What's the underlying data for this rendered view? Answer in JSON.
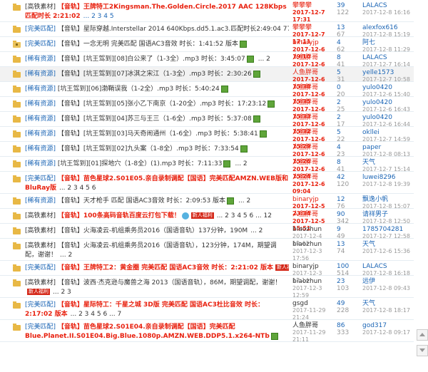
{
  "rows": [
    {
      "h": 30,
      "shade": false,
      "icon": "folder",
      "tag": "[高铁素材]",
      "tag_blue": false,
      "title": "【音轨】王牌特工2Kingsman.The.Golden.Circle.2017 AAC 128Kbps 匹配时长 2:21:02",
      "red": true,
      "extra": "",
      "pages": "... 2 3 4 5",
      "pages_blue": true,
      "author": "攀攀攀",
      "date": "2017-12-7 17:31",
      "date_red": true,
      "replies": "39",
      "views": "122",
      "last": "LALACS",
      "last_date": "2017-12-8 16:16"
    },
    {
      "h": 20,
      "shade": false,
      "icon": "folder",
      "tag": "[完美匹配]",
      "tag_blue": true,
      "title": "【音轨】星际穿越.Interstellar 2014 640Kbps.dd5.1.ac3.匹配时长2:49:04 774MB",
      "red": false,
      "extra": "ico",
      "pages": "... 2",
      "pages_blue": false,
      "author": "攀攀攀",
      "date": "2017-12-7 17:11",
      "date_red": true,
      "replies": "13",
      "views": "67",
      "last": "alexfox616",
      "last_date": "2017-12-8 15:19"
    },
    {
      "h": 20,
      "shade": false,
      "icon": "lock",
      "tag": "[完美匹配]",
      "tag_blue": true,
      "title": "【音轨】一念无明 完美匹配 国语AC3音效 时长：1:41:52 版本",
      "red": false,
      "extra": "ico",
      "pages": "",
      "pages_blue": false,
      "author": "binaryjp",
      "date": "2017-12-6 19:10",
      "date_red": true,
      "replies": "4",
      "views": "62",
      "last": "阿七",
      "last_date": "2017-12-8 11:29"
    },
    {
      "h": 20,
      "shade": false,
      "icon": "folder",
      "tag": "[稀有资源]",
      "tag_blue": true,
      "title": "【音轨】[坑王驾到][08]白公来了（1-3全）.mp3 时长：3:45:07",
      "red": false,
      "extra": "ico",
      "pages": "... 2",
      "pages_blue": false,
      "author": "人鱼胖哥",
      "date": "2017-12-6 15:39",
      "date_red": true,
      "replies": "8",
      "views": "41",
      "last": "LALACS",
      "last_date": "2017-12-7 16:14"
    },
    {
      "h": 20,
      "shade": true,
      "icon": "folder",
      "tag": "[稀有资源]",
      "tag_blue": true,
      "title": "【音轨】[坑王驾到][07]冰淇之宋江（1-3全）.mp3 时长：2:30:26",
      "red": false,
      "extra": "ico",
      "pages": "",
      "pages_blue": false,
      "author": "人鱼胖哥",
      "date": "2017-12-6 15:38",
      "date_red": true,
      "replies": "5",
      "views": "31",
      "last": "yelle1573",
      "last_date": "2017-12-7 10:58"
    },
    {
      "h": 20,
      "shade": false,
      "icon": "folder",
      "tag": "[稀有资源]",
      "tag_blue": true,
      "title": "[坑王驾到][06]渤鞘误我（1-2全）.mp3 时长：5:40:24",
      "red": false,
      "extra": "ico",
      "pages": "",
      "pages_blue": false,
      "author": "人鱼胖哥",
      "date": "2017-12-6 15:35",
      "date_red": true,
      "replies": "0",
      "views": "20",
      "last": "yulo0420",
      "last_date": "2017-12-6 15:40"
    },
    {
      "h": 20,
      "shade": false,
      "icon": "folder",
      "tag": "[稀有资源]",
      "tag_blue": true,
      "title": "【音轨】[坑王驾到][05]张小乙下南京（1-20全）.mp3 时长：17:23:12",
      "red": false,
      "extra": "ico",
      "pages": "",
      "pages_blue": false,
      "author": "人鱼胖哥",
      "date": "2017-12-6 15:33",
      "date_red": true,
      "replies": "2",
      "views": "25",
      "last": "yulo0420",
      "last_date": "2017-12-6 16:43"
    },
    {
      "h": 20,
      "shade": false,
      "icon": "folder",
      "tag": "[稀有资源]",
      "tag_blue": true,
      "title": "【音轨】[坑王驾到][04]苏三与王三（1-6全）.mp3 时长：5:37:08",
      "red": false,
      "extra": "ico",
      "pages": "",
      "pages_blue": false,
      "author": "人鱼胖哥",
      "date": "2017-12-6 15:32",
      "date_red": true,
      "replies": "2",
      "views": "17",
      "last": "yulo0420",
      "last_date": "2017-12-6 16:44"
    },
    {
      "h": 20,
      "shade": false,
      "icon": "folder",
      "tag": "[稀有资源]",
      "tag_blue": true,
      "title": "【音轨】[坑王驾到][03]马天奇闹通州（1-6全）.mp3 时长：5:38:41",
      "red": false,
      "extra": "ico",
      "pages": "",
      "pages_blue": false,
      "author": "人鱼胖哥",
      "date": "2017-12-6 15:29",
      "date_red": true,
      "replies": "5",
      "views": "22",
      "last": "okllei",
      "last_date": "2017-12-7 14:59"
    },
    {
      "h": 20,
      "shade": false,
      "icon": "folder",
      "tag": "[稀有资源]",
      "tag_blue": true,
      "title": "【音轨】[坑王驾到][02]九头案（1-8全）.mp3 时长：7:33:54",
      "red": false,
      "extra": "ico",
      "pages": "",
      "pages_blue": false,
      "author": "人鱼胖哥",
      "date": "2017-12-6 15:26",
      "date_red": true,
      "replies": "4",
      "views": "23",
      "last": "paper",
      "last_date": "2017-12-8 08:13"
    },
    {
      "h": 20,
      "shade": false,
      "icon": "folder",
      "tag": "[稀有资源]",
      "tag_blue": true,
      "title": "[坑王驾到][01]探地穴（1-8全）(1).mp3 时长：7:11:33",
      "red": false,
      "extra": "ico",
      "pages": "... 2",
      "pages_blue": false,
      "author": "人鱼胖哥",
      "date": "2017-12-6 15:24",
      "date_red": true,
      "replies": "8",
      "views": "41",
      "last": "天气",
      "last_date": "2017-12-7 15:14"
    },
    {
      "h": 30,
      "shade": false,
      "icon": "folder",
      "tag": "[完美匹配]",
      "tag_blue": true,
      "title": "【音轨】苗色星球2.S01E05.亲自录制调配【国语】完美匹配AMZN.WEB版和BluRay版",
      "red": true,
      "extra": "",
      "pages": "... 2 3 4 5 6",
      "pages_blue": false,
      "author": "人鱼胖哥",
      "date": "2017-12-6 09:04",
      "date_red": true,
      "replies": "42",
      "views": "120",
      "last": "luwei8296",
      "last_date": "2017-12-8 19:39"
    },
    {
      "h": 20,
      "shade": false,
      "icon": "folder",
      "tag": "[稀有资源]",
      "tag_blue": true,
      "title": "【音轨】天才枪手 匹配 国语AC3音效 时长：2:09:53 版本",
      "red": false,
      "extra": "ico",
      "pages": "... 2",
      "pages_blue": false,
      "author": "binaryjp",
      "date": "2017-12-5 23:34",
      "date_red": true,
      "replies": "12",
      "views": "76",
      "last": "飘逸小帆",
      "last_date": "2017-12-8 15:07"
    },
    {
      "h": 20,
      "shade": false,
      "icon": "folder",
      "tag": "[高铁素材]",
      "tag_blue": false,
      "title": "【音轨】100条高码音轨百度云打包下载！",
      "red": true,
      "extra": "hot",
      "pages": "... 2 3 4 5 6 ... 12",
      "pages_blue": false,
      "author": "人鱼胖哥",
      "date": "2017-12-5 15:51",
      "date_red": true,
      "replies": "90",
      "views": "342",
      "last": "请祥男子",
      "last_date": "2017-12-8 12:50"
    },
    {
      "h": 20,
      "shade": false,
      "icon": "folder",
      "tag": "[高铁素材]",
      "tag_blue": false,
      "title": "【音轨】火海凌云-机组乘务员2016（国语音轨）137分钟，190M",
      "red": false,
      "extra": "",
      "pages": "... 2",
      "pages_blue": false,
      "author": "biaozhun",
      "date": "2017-12-4 19:47",
      "date_red": false,
      "replies": "9",
      "views": "49",
      "last": "1785704281",
      "last_date": "2017-12-7 12:58"
    },
    {
      "h": 30,
      "shade": false,
      "icon": "folder",
      "tag": "[高铁素材]",
      "tag_blue": false,
      "title": "【音轨】火海凌云-机组乘务员2016（国语音轨），123分钟，174M，期望调配，谢谢！",
      "red": false,
      "extra": "",
      "pages": "... 2",
      "pages_blue": false,
      "author": "biaozhun",
      "date": "2017-12-3 17:56",
      "date_red": false,
      "replies": "13",
      "views": "74",
      "last": "天气",
      "last_date": "2017-12-6 15:36"
    },
    {
      "h": 20,
      "shade": false,
      "icon": "folder",
      "tag": "[完美匹配]",
      "tag_blue": true,
      "title": "【音轨】王牌特工2：黄金圈 完美匹配 国语AC3音效 时长：2:21:02 版本",
      "red": true,
      "extra": "hotico",
      "pages": "",
      "pages_blue": false,
      "author": "binaryjp",
      "date": "2017-12-3 17:14",
      "date_red": false,
      "replies": "100",
      "views": "514",
      "last": "LALACS",
      "last_date": "2017-12-8 16:18"
    },
    {
      "h": 30,
      "shade": false,
      "icon": "folder",
      "tag": "[高铁素材]",
      "tag_blue": false,
      "title": "【音轨】波西·杰克逊与魔兽之海 2013（国语音轨），86M，期望调配，谢谢！",
      "red": false,
      "extra": "hot2",
      "pages": "... 2 3",
      "pages_blue": false,
      "author": "biaozhun",
      "date": "2017-12-3 12:59",
      "date_red": false,
      "replies": "23",
      "views": "103",
      "last": "远伊",
      "last_date": "2017-12-8 09:43"
    },
    {
      "h": 30,
      "shade": false,
      "icon": "folder",
      "tag": "[完美匹配]",
      "tag_blue": true,
      "title": "【音轨】星际特工：千星之城 3D版 完美匹配 国语AC3杜比音效 时长：2:17:02 版本",
      "red": true,
      "extra": "",
      "pages": "... 2 3 4 5 6 ... 7",
      "pages_blue": false,
      "author": "gsgd",
      "date": "2017-11-29 21:24",
      "date_red": false,
      "replies": "49",
      "views": "228",
      "last": "天气",
      "last_date": "2017-12-8 18:17"
    },
    {
      "h": 30,
      "shade": false,
      "icon": "folder",
      "tag": "[完美匹配]",
      "tag_blue": true,
      "title": "【音轨】苗色星球2.S01E04.亲自录制调配【国语】完美匹配 Blue.Planet.II.S01E04.Big.Blue.1080p.AMZN.WEB.DDP5.1.x264-NTb",
      "red": true,
      "extra": "wrap",
      "pages": "",
      "pages_blue": false,
      "author": "人鱼胖哥",
      "date": "2017-11-29 21:11",
      "date_red": false,
      "replies": "86",
      "views": "333",
      "last": "god317",
      "last_date": "2017-12-8 09:17"
    }
  ],
  "labels": {
    "hot": "新人福利",
    "hot2": "新人福利"
  },
  "colors": {
    "accent_red": "#e8200e",
    "link_blue": "#1b65b5"
  }
}
